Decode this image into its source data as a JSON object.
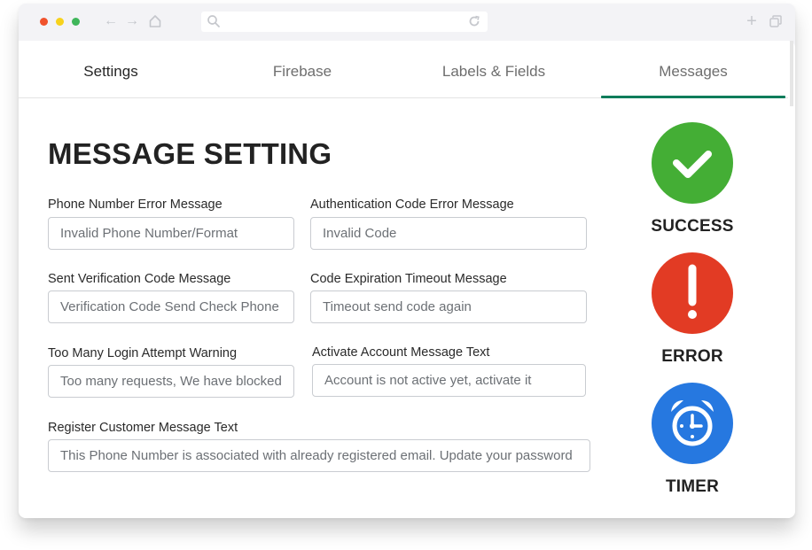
{
  "browser": {
    "url": "",
    "traffic_lights": [
      "close",
      "minimize",
      "maximize"
    ],
    "icons": {
      "back": "arrow-left-icon",
      "forward": "arrow-right-icon",
      "home": "home-icon",
      "search": "search-icon",
      "reload": "reload-icon",
      "new_tab": "plus-icon",
      "tabs": "copy-icon"
    }
  },
  "tabs": [
    {
      "label": "Settings",
      "active": false
    },
    {
      "label": "Firebase",
      "active": false
    },
    {
      "label": "Labels & Fields",
      "active": false
    },
    {
      "label": "Messages",
      "active": true
    }
  ],
  "accent_color": "#0b7c5a",
  "page_title": "MESSAGE SETTING",
  "fields": {
    "phone_error": {
      "label": "Phone Number Error Message",
      "placeholder": "Invalid Phone Number/Format"
    },
    "auth_code_error": {
      "label": "Authentication Code Error Message",
      "placeholder": "Invalid Code"
    },
    "sent_verification": {
      "label": "Sent Verification Code Message",
      "placeholder": "Verification Code Send Check Phone"
    },
    "code_expiration": {
      "label": "Code Expiration Timeout Message",
      "placeholder": "Timeout send code again"
    },
    "too_many_attempts": {
      "label": "Too Many Login Attempt Warning",
      "placeholder": "Too many requests, We have blocked"
    },
    "activate_account": {
      "label": "Activate Account Message Text",
      "placeholder": "Account is not active yet, activate it"
    },
    "register_customer": {
      "label": "Register Customer Message Text",
      "placeholder": "This Phone Number is associated with already registered email. Update your password"
    }
  },
  "statuses": [
    {
      "label": "SUCCESS",
      "icon": "checkmark-icon",
      "color": "#44ae35"
    },
    {
      "label": "ERROR",
      "icon": "exclamation-icon",
      "color": "#e23b24"
    },
    {
      "label": "TIMER",
      "icon": "alarm-clock-icon",
      "color": "#2678e0"
    }
  ]
}
